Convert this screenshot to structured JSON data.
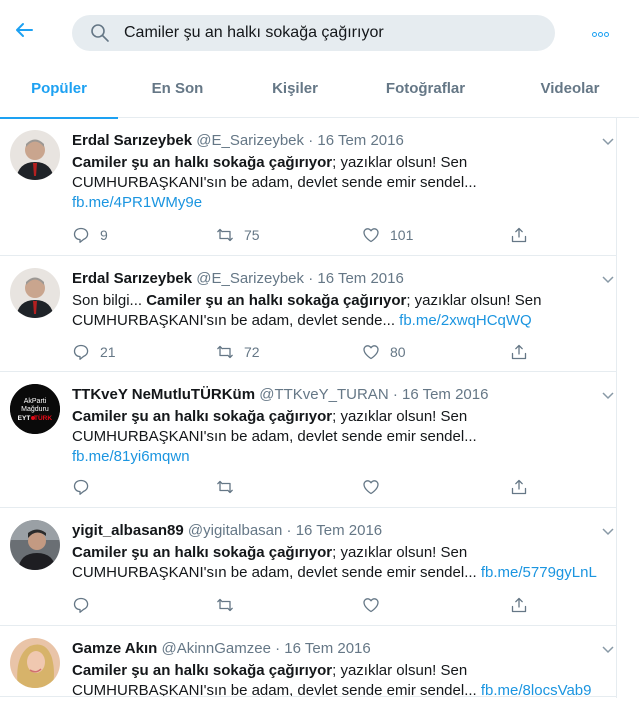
{
  "search": {
    "value": "Camiler şu an halkı sokağa çağırıyor"
  },
  "colors": {
    "accent": "#1da1f2",
    "link": "#1b95e0",
    "muted": "#657786",
    "text": "#14171a"
  },
  "tabs": [
    {
      "label": "Popüler",
      "active": true
    },
    {
      "label": "En Son"
    },
    {
      "label": "Kişiler"
    },
    {
      "label": "Fotoğraflar"
    },
    {
      "label": "Videolar"
    }
  ],
  "tweets": [
    {
      "name": "Erdal Sarızeybek",
      "handle": "@E_Sarizeybek",
      "date": "· 16 Tem 2016",
      "pre": "",
      "bold": "Camiler şu an halkı sokağa çağırıyor",
      "rest": "; yazıklar olsun! Sen CUMHURBAŞKANI'sın be adam, devlet sende emir sendel...",
      "link": "fb.me/4PR1WMy9e",
      "replies": "9",
      "retweets": "75",
      "likes": "101"
    },
    {
      "name": "Erdal Sarızeybek",
      "handle": "@E_Sarizeybek",
      "date": "· 16 Tem 2016",
      "pre": "Son bilgi... ",
      "bold": "Camiler şu an halkı sokağa çağırıyor",
      "rest": "; yazıklar olsun! Sen CUMHURBAŞKANI'sın be adam, devlet sende... ",
      "link": "fb.me/2xwqHCqWQ",
      "replies": "21",
      "retweets": "72",
      "likes": "80"
    },
    {
      "name": "TTKveY NeMutluTÜRKüm",
      "handle": "@TTKveY_TURAN",
      "date": "· 16 Tem 2016",
      "pre": "",
      "bold": "Camiler şu an halkı sokağa çağırıyor",
      "rest": "; yazıklar olsun! Sen CUMHURBAŞKANI'sın be adam, devlet sende emir sendel...",
      "link": "fb.me/81yi6mqwn",
      "replies": "",
      "retweets": "",
      "likes": "",
      "avatar_text": [
        "AkParti",
        "Mağduru",
        "EYT",
        "TÜRK"
      ]
    },
    {
      "name": "yigit_albasan89",
      "handle": "@yigitalbasan",
      "date": "· 16 Tem 2016",
      "pre": "",
      "bold": "Camiler şu an halkı sokağa çağırıyor",
      "rest": "; yazıklar olsun! Sen CUMHURBAŞKANI'sın be adam, devlet sende emir sendel... ",
      "link": "fb.me/5779gyLnL",
      "replies": "",
      "retweets": "",
      "likes": ""
    },
    {
      "name": "Gamze Akın",
      "handle": "@AkinnGamzee",
      "date": "· 16 Tem 2016",
      "pre": "",
      "bold": "Camiler şu an halkı sokağa çağırıyor",
      "rest": "; yazıklar olsun! Sen CUMHURBAŞKANI'sın be adam, devlet sende emir sendel... ",
      "link": "fb.me/8locsVab9",
      "replies": "",
      "retweets": "",
      "likes": ""
    }
  ]
}
